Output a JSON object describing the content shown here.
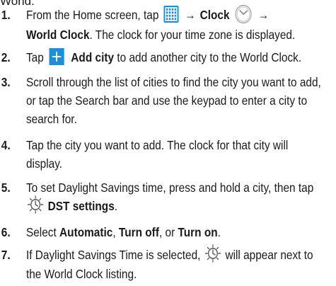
{
  "header_fragment": "World.",
  "steps": [
    {
      "num": "1.",
      "lines": {
        "a": "From the Home screen, tap",
        "arrow1": "→",
        "clock_label": "Clock",
        "arrow2": "→",
        "world_clock": "World Clock",
        "rest": ". The clock for your time zone is displayed."
      }
    },
    {
      "num": "2.",
      "lines": {
        "a": "Tap",
        "add_city": "Add city",
        "rest": "to add another city to the World Clock."
      }
    },
    {
      "num": "3.",
      "text": "Scroll through the list of cities to find the city you want to add, or tap the Search bar and use the keypad to enter a city to search for."
    },
    {
      "num": "4.",
      "text": "Tap the city you want to add. The clock for that city will display."
    },
    {
      "num": "5.",
      "lines": {
        "a": "To set Daylight Savings time, press and hold a city, then tap",
        "dst": "DST settings",
        "end": "."
      }
    },
    {
      "num": "6.",
      "lines": {
        "a": "Select",
        "auto": "Automatic",
        "c1": ",",
        "off": "Turn off",
        "c2": ", or",
        "on": "Turn on",
        "end": "."
      }
    },
    {
      "num": "7.",
      "lines": {
        "a": "If Daylight Savings Time is selected,",
        "b": "will appear next to the World Clock listing."
      }
    }
  ],
  "colors": {
    "icon_blue": "#1e8fd6",
    "text": "#1a1a1a"
  },
  "icons": [
    "apps-grid-icon",
    "clock-icon",
    "add-plus-icon",
    "dst-sun-clock-icon"
  ]
}
